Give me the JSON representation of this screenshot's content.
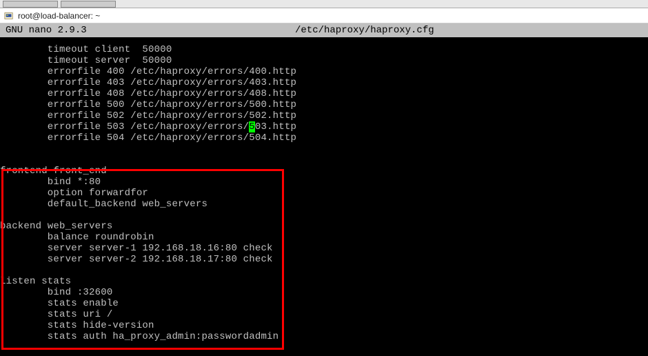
{
  "titlebar": {
    "title": "root@load-balancer: ~"
  },
  "editor_header": {
    "left": "  GNU nano 2.9.3",
    "filepath": "/etc/haproxy/haproxy.cfg"
  },
  "lines": {
    "l01": "        timeout client  50000",
    "l02": "        timeout server  50000",
    "l03": "        errorfile 400 /etc/haproxy/errors/400.http",
    "l04": "        errorfile 403 /etc/haproxy/errors/403.http",
    "l05": "        errorfile 408 /etc/haproxy/errors/408.http",
    "l06": "        errorfile 500 /etc/haproxy/errors/500.http",
    "l07": "        errorfile 502 /etc/haproxy/errors/502.http",
    "l08a": "        errorfile 503 /etc/haproxy/errors/",
    "l08cursor": "5",
    "l08b": "03.http",
    "l09": "        errorfile 504 /etc/haproxy/errors/504.http",
    "l10": "",
    "l11": "",
    "l12": "frontend front_end",
    "l13": "        bind *:80",
    "l14": "        option forwardfor",
    "l15": "        default_backend web_servers",
    "l16": "",
    "l17": "backend web_servers",
    "l18": "        balance roundrobin",
    "l19": "        server server-1 192.168.18.16:80 check",
    "l20": "        server server-2 192.168.18.17:80 check",
    "l21": "",
    "l22": "listen stats",
    "l23": "        bind :32600",
    "l24": "        stats enable",
    "l25": "        stats uri /",
    "l26": "        stats hide-version",
    "l27": "        stats auth ha_proxy_admin:passwordadmin"
  }
}
